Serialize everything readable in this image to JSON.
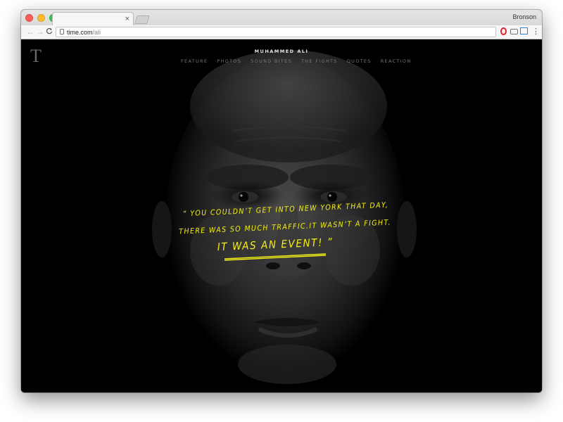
{
  "browser": {
    "profile_name": "Bronson",
    "tab": {
      "title": "",
      "close_glyph": "×"
    },
    "nav": {
      "back_glyph": "←",
      "forward_glyph": "→",
      "reload_glyph": "C"
    },
    "address": {
      "domain": "time.com",
      "path": "/ali"
    },
    "menu_glyph": "⋮",
    "extensions": [
      "opera-icon",
      "camera-icon",
      "screenshot-icon"
    ]
  },
  "site": {
    "logo": "T",
    "title": "MUHAMMED ALI",
    "nav_items": [
      "FEATURE",
      "PHOTOS",
      "SOUND BITES",
      "THE FIGHTS",
      "QUOTES",
      "REACTION"
    ]
  },
  "quote": {
    "line1": "“ YOU COULDN’T GET INTO NEW YORK THAT DAY,",
    "line2": "THERE WAS SO MUCH TRAFFIC.IT WASN’T A FIGHT.",
    "line3": "IT WAS AN EVENT! ”",
    "color": "#f2ee16"
  },
  "colors": {
    "page_background": "#000000",
    "nav_text": "#777777",
    "accent": "#f2ee16"
  }
}
